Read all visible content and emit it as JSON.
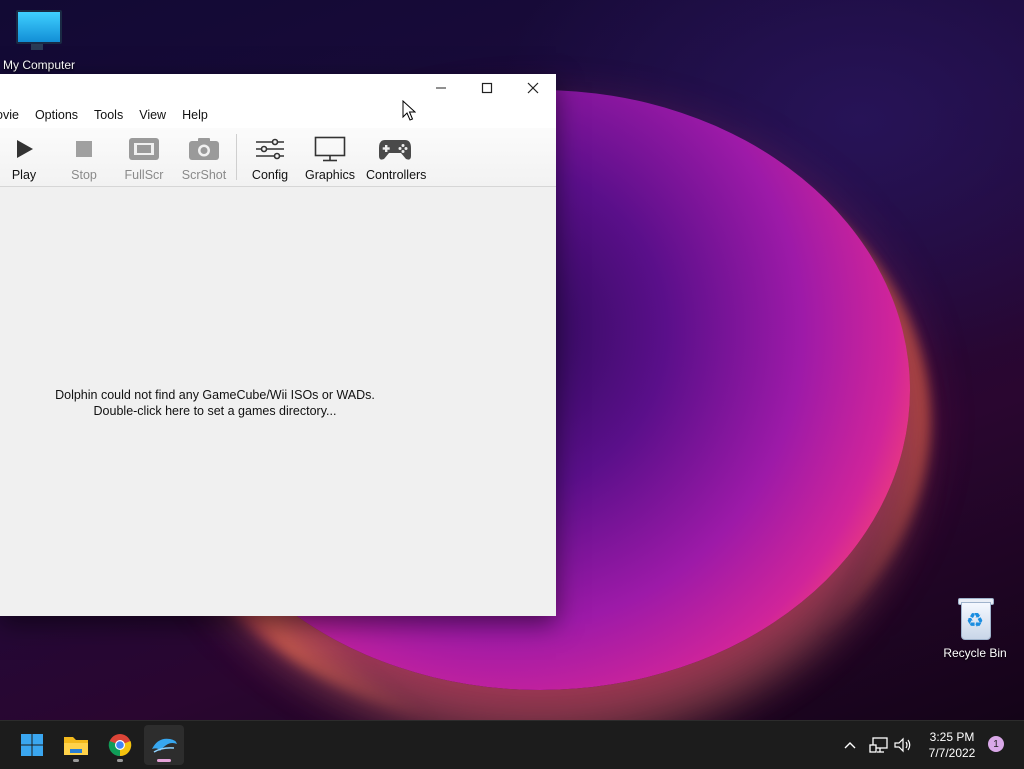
{
  "desktop": {
    "icons": [
      {
        "label": "My Computer",
        "icon": "monitor-icon"
      },
      {
        "label": "Recycle Bin",
        "icon": "recycle-bin-icon"
      }
    ]
  },
  "window": {
    "title_buttons": {
      "minimize": "minimize-icon",
      "maximize": "maximize-icon",
      "close": "close-icon"
    },
    "menu": [
      "ovie",
      "Options",
      "Tools",
      "View",
      "Help"
    ],
    "toolbar": [
      {
        "label": "Play",
        "icon": "play-icon",
        "enabled": true
      },
      {
        "label": "Stop",
        "icon": "stop-icon",
        "enabled": false
      },
      {
        "label": "FullScr",
        "icon": "fullscreen-icon",
        "enabled": false
      },
      {
        "label": "ScrShot",
        "icon": "camera-icon",
        "enabled": false
      },
      {
        "label": "Config",
        "icon": "sliders-icon",
        "enabled": true
      },
      {
        "label": "Graphics",
        "icon": "monitor-icon",
        "enabled": true
      },
      {
        "label": "Controllers",
        "icon": "gamepad-icon",
        "enabled": true
      }
    ],
    "empty_message": {
      "line1": "Dolphin could not find any GameCube/Wii ISOs or WADs.",
      "line2": "Double-click here to set a games directory..."
    }
  },
  "taskbar": {
    "apps": [
      {
        "name": "start",
        "icon": "windows-start-icon"
      },
      {
        "name": "file-explorer",
        "icon": "folder-icon"
      },
      {
        "name": "chrome",
        "icon": "chrome-icon"
      },
      {
        "name": "dolphin",
        "icon": "dolphin-icon"
      }
    ],
    "clock": {
      "time": "3:25 PM",
      "date": "7/7/2022"
    },
    "notification_count": "1"
  }
}
